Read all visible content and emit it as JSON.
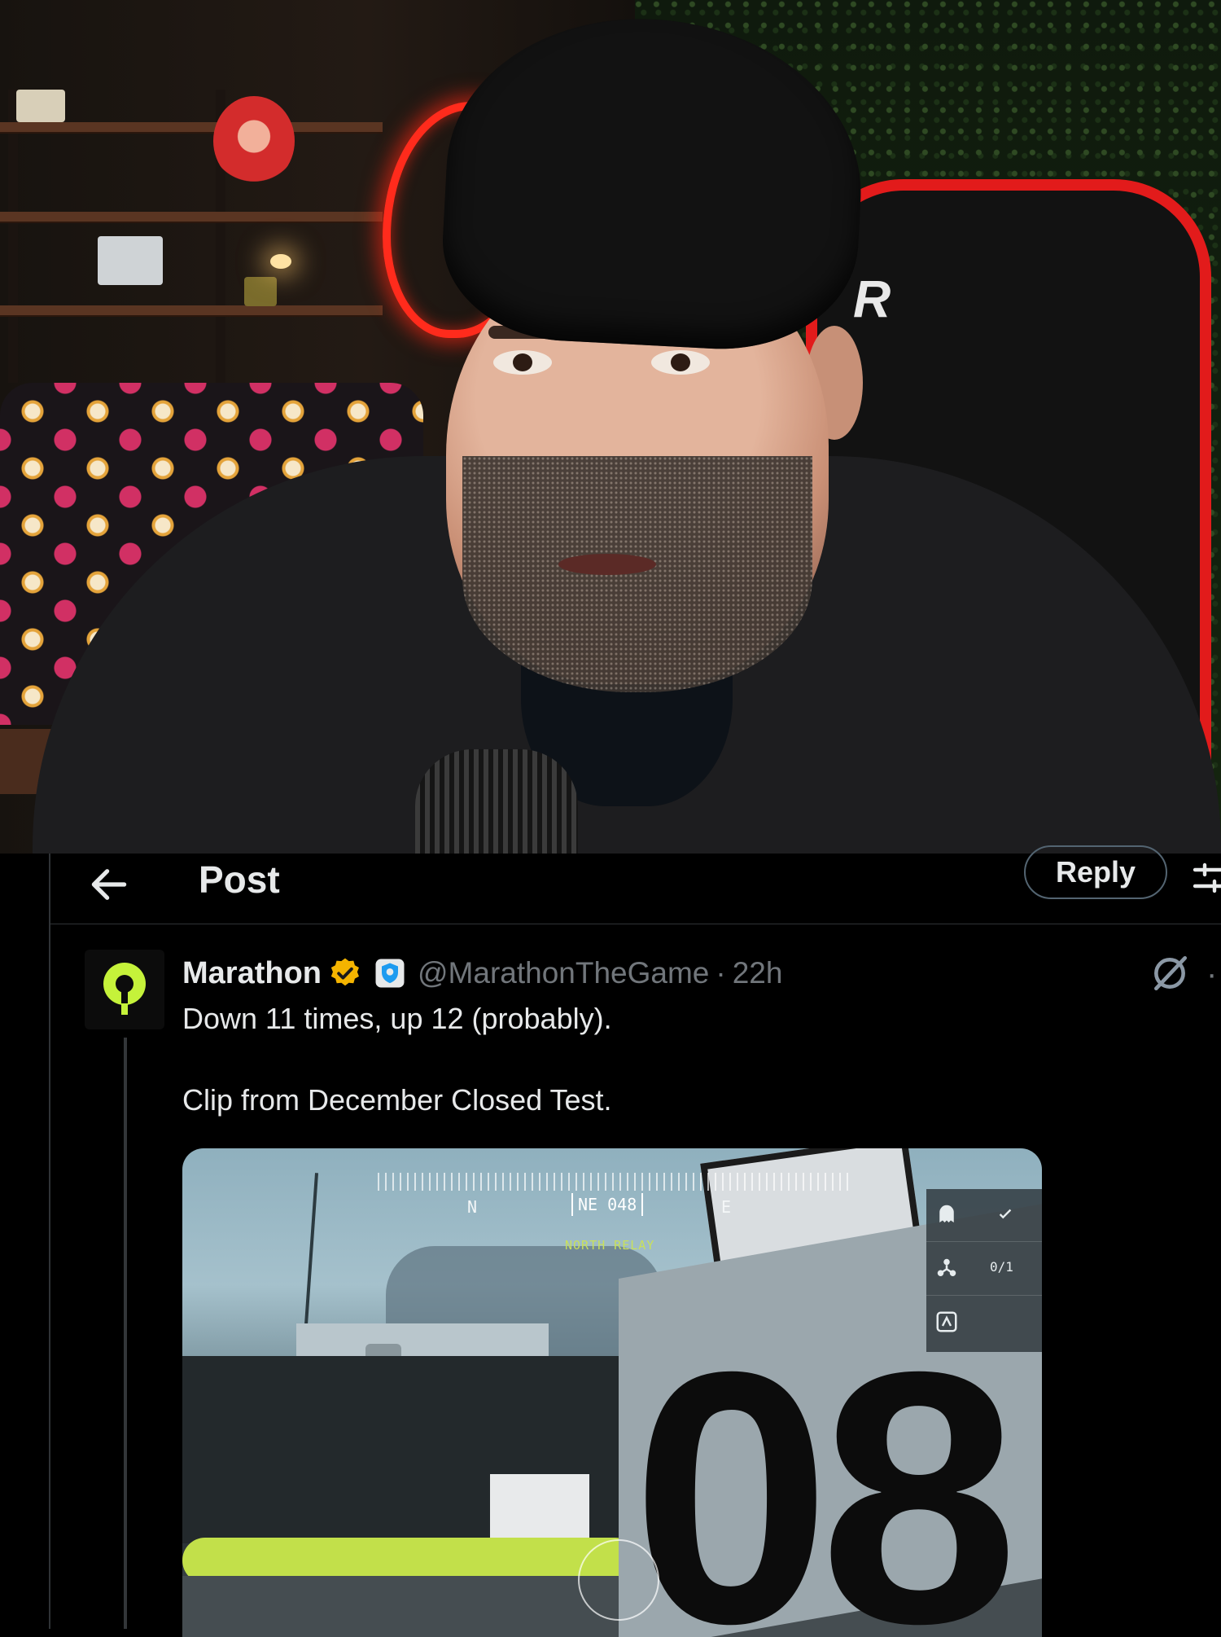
{
  "header": {
    "title": "Post",
    "reply_label": "Reply"
  },
  "post": {
    "display_name": "Marathon",
    "handle": "@MarathonTheGame",
    "separator": "·",
    "time": "22h",
    "text_line_1": "Down 11 times, up 12 (probably).",
    "text_line_2": "Clip from December Closed Test.",
    "avatar_color": "#c5f23a"
  },
  "media": {
    "hud": {
      "compass_left": "N",
      "compass_heading": "NE 048",
      "compass_right": "E",
      "location_label": "NORTH RELAY",
      "objective_count": "0/1",
      "panel_number": "08"
    }
  },
  "webcam": {
    "chair_logo": "R"
  },
  "colors": {
    "background": "#000000",
    "text_primary": "#e7e9ea",
    "text_secondary": "#71767b",
    "verified": "#f4b400",
    "affiliate": "#1d9bf0"
  },
  "icons": {
    "back": "arrow-left-icon",
    "settings": "sliders-icon",
    "verified": "verified-badge-icon",
    "affiliate": "shield-affiliate-icon",
    "grok": "grok-icon"
  }
}
